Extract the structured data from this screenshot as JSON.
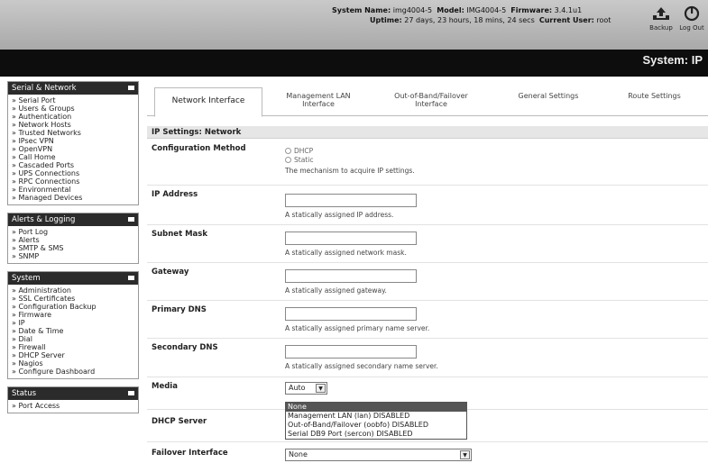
{
  "header": {
    "system_name_label": "System Name:",
    "system_name": "img4004-5",
    "model_label": "Model:",
    "model": "IMG4004-5",
    "firmware_label": "Firmware:",
    "firmware": "3.4.1u1",
    "uptime_label": "Uptime:",
    "uptime": "27 days, 23 hours, 18 mins, 24 secs",
    "current_user_label": "Current User:",
    "current_user": "root",
    "backup_label": "Backup",
    "logout_label": "Log Out",
    "page_title": "System: IP"
  },
  "sidebar": {
    "sections": [
      {
        "title": "Serial & Network",
        "items": [
          "Serial Port",
          "Users & Groups",
          "Authentication",
          "Network Hosts",
          "Trusted Networks",
          "IPsec VPN",
          "OpenVPN",
          "Call Home",
          "Cascaded Ports",
          "UPS Connections",
          "RPC Connections",
          "Environmental",
          "Managed Devices"
        ]
      },
      {
        "title": "Alerts & Logging",
        "items": [
          "Port Log",
          "Alerts",
          "SMTP & SMS",
          "SNMP"
        ]
      },
      {
        "title": "System",
        "items": [
          "Administration",
          "SSL Certificates",
          "Configuration Backup",
          "Firmware",
          "IP",
          "Date & Time",
          "Dial",
          "Firewall",
          "DHCP Server",
          "Nagios",
          "Configure Dashboard"
        ]
      },
      {
        "title": "Status",
        "items": [
          "Port Access"
        ]
      }
    ]
  },
  "tabs": {
    "network_interface": "Network Interface",
    "management_lan_1": "Management LAN",
    "management_lan_2": "Interface",
    "oob_1": "Out-of-Band/Failover",
    "oob_2": "Interface",
    "general_settings": "General Settings",
    "route_settings": "Route Settings"
  },
  "form": {
    "section_title": "IP Settings: Network",
    "config_method_label": "Configuration Method",
    "dhcp_option": "DHCP",
    "static_option": "Static",
    "config_method_hint": "The mechanism to acquire IP settings.",
    "ip_address_label": "IP Address",
    "ip_address_value": "",
    "ip_address_hint": "A statically assigned IP address.",
    "subnet_mask_label": "Subnet Mask",
    "subnet_mask_value": "",
    "subnet_mask_hint": "A statically assigned network mask.",
    "gateway_label": "Gateway",
    "gateway_value": "",
    "gateway_hint": "A statically assigned gateway.",
    "primary_dns_label": "Primary DNS",
    "primary_dns_value": "",
    "primary_dns_hint": "A statically assigned primary name server.",
    "secondary_dns_label": "Secondary DNS",
    "secondary_dns_value": "",
    "secondary_dns_hint": "A statically assigned secondary name server.",
    "media_label": "Media",
    "media_value": "Auto",
    "dhcp_server_label": "DHCP Server",
    "failover_label": "Failover Interface",
    "failover_value": "None"
  },
  "failover_dropdown": {
    "options": [
      "None",
      "Management LAN (lan) DISABLED",
      "Out-of-Band/Failover (oobfo) DISABLED",
      "Serial DB9 Port (sercon) DISABLED"
    ],
    "highlighted_index": 0
  }
}
